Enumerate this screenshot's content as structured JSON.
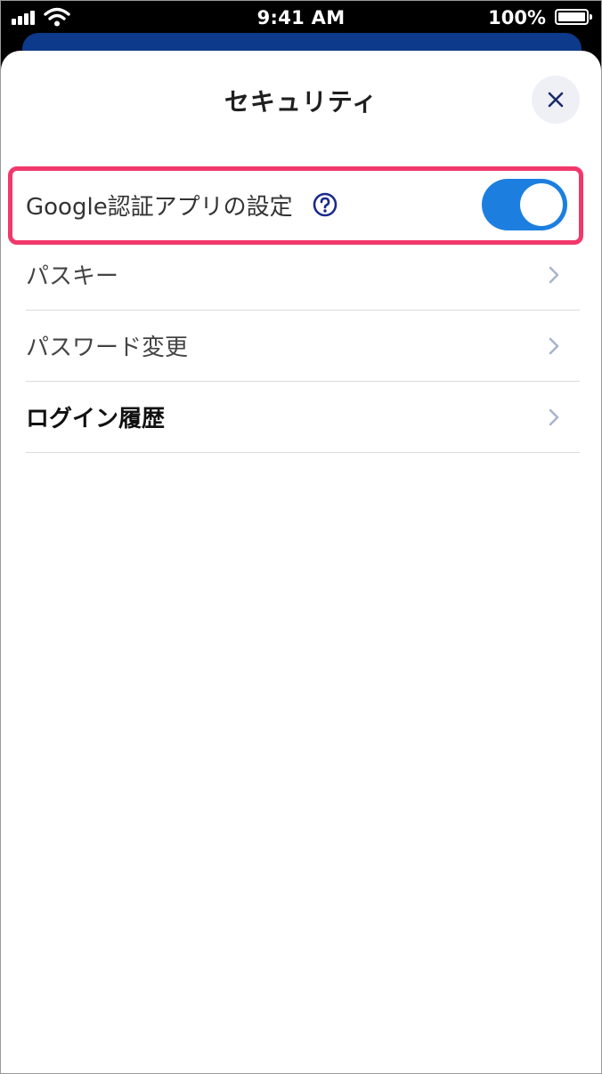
{
  "status_bar": {
    "time": "9:41 AM",
    "battery": "100%"
  },
  "sheet": {
    "title": "セキュリティ"
  },
  "security_items": [
    {
      "label": "Google認証アプリの設定",
      "type": "toggle",
      "enabled": true
    },
    {
      "label": "パスキー",
      "type": "link"
    },
    {
      "label": "パスワード変更",
      "type": "link"
    },
    {
      "label": "ログイン履歴",
      "type": "link"
    }
  ],
  "colors": {
    "accent": "#1c7fe0",
    "highlight": "#f0386b",
    "close_icon": "#1a2a6b",
    "help_icon": "#1a2a8b",
    "chevron": "#a8b4cc"
  },
  "icons": [
    "signal-icon",
    "wifi-icon",
    "battery-icon",
    "close-icon",
    "help-icon",
    "chevron-right-icon"
  ]
}
